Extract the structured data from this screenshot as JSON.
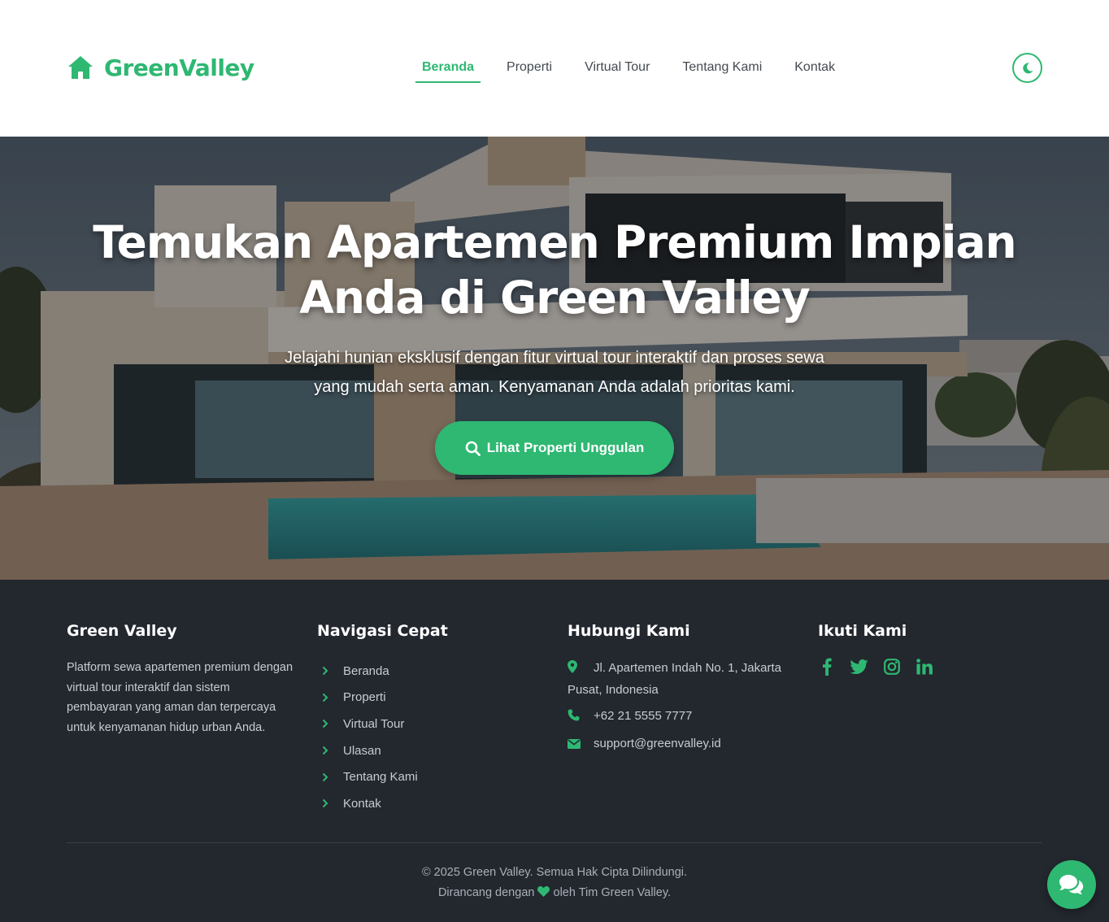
{
  "brand": {
    "name": "GreenValley",
    "accent_color": "#2eb872",
    "icon": "home-icon"
  },
  "nav": {
    "items": [
      "Beranda",
      "Properti",
      "Virtual Tour",
      "Tentang Kami",
      "Kontak"
    ],
    "active": "Beranda",
    "theme_toggle_icon": "moon-icon"
  },
  "hero": {
    "title_line1": "Temukan Apartemen Premium Impian",
    "title_line2": "Anda di Green Valley",
    "subtitle": "Jelajahi hunian eksklusif dengan fitur virtual tour interaktif dan proses sewa yang mudah serta aman. Kenyamanan Anda adalah prioritas kami.",
    "cta_label": "Lihat Properti Unggulan",
    "cta_icon": "search-icon"
  },
  "footer": {
    "about": {
      "heading": "Green Valley",
      "text": "Platform sewa apartemen premium dengan virtual tour interaktif dan sistem pembayaran yang aman dan terpercaya untuk kenyamanan hidup urban Anda."
    },
    "quick_nav": {
      "heading": "Navigasi Cepat",
      "links": [
        "Beranda",
        "Properti",
        "Virtual Tour",
        "Ulasan",
        "Tentang Kami",
        "Kontak"
      ]
    },
    "contact": {
      "heading": "Hubungi Kami",
      "address": "Jl. Apartemen Indah No. 1, Jakarta Pusat, Indonesia",
      "phone": "+62 21 5555 7777",
      "email": "support@greenvalley.id"
    },
    "social": {
      "heading": "Ikuti Kami",
      "icons": [
        "facebook-icon",
        "twitter-icon",
        "instagram-icon",
        "linkedin-icon"
      ]
    },
    "copyright": "© 2025 Green Valley. Semua Hak Cipta Dilindungi.",
    "credit_prefix": "Dirancang dengan",
    "credit_suffix": "oleh Tim Green Valley."
  },
  "colors": {
    "footer_bg": "#23272e",
    "accent": "#2eb872"
  }
}
